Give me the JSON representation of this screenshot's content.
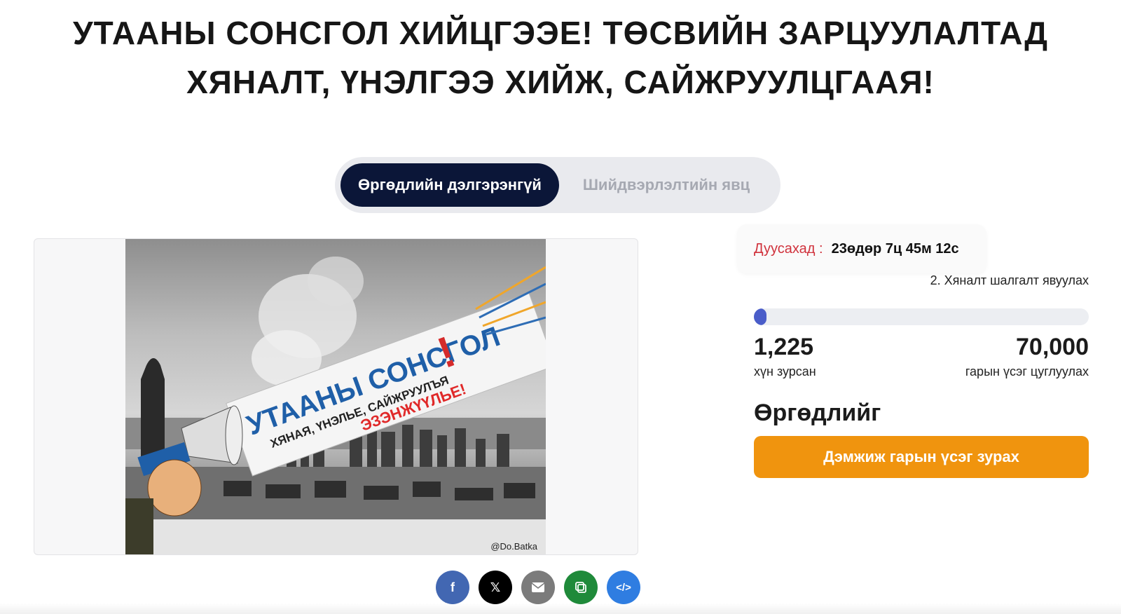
{
  "title": {
    "line1": "УТААНЫ СОНСГОЛ ХИЙЦГЭЭЕ! ТӨСВИЙН ЗАРЦУУЛАЛТАД",
    "line2": "ХЯНАЛТ, ҮНЭЛГЭЭ ХИЙЖ, САЙЖРУУЛЦГААЯ!"
  },
  "tabs": [
    {
      "label": "Өргөдлийн дэлгэрэнгүй",
      "active": true
    },
    {
      "label": "Шийдвэрлэлтийн явц",
      "active": false
    }
  ],
  "poster": {
    "headline": "УТААНЫ СОНСГОЛ",
    "exclaim": "!",
    "subline": "ХЯНАЯ, ҮНЭЛЬЕ, САЙЖРУУЛЪЯ",
    "accent_line": "ЭЗЭНЖҮҮЛЬЕ!",
    "credit": "@Do.Batka"
  },
  "countdown": {
    "label": "Дуусахад :",
    "value": "23өдөр 7ц 45м 12с"
  },
  "stage": "2. Хяналт шалгалт явуулах",
  "progress": {
    "signed": "1,225",
    "signed_label": "хүн зурсан",
    "goal": "70,000",
    "goal_label": "гарын үсэг цуглуулах",
    "fraction": 0.0175
  },
  "petition_heading": "Өргөдлийг",
  "sign_button": "Дэмжиж гарын үсэг зурах",
  "share": [
    {
      "icon": "facebook-icon",
      "glyph": "f",
      "color": "#4267b2"
    },
    {
      "icon": "x-icon",
      "glyph": "𝕏",
      "color": "#000000"
    },
    {
      "icon": "email-icon",
      "glyph": "",
      "color": "#7b7b7b"
    },
    {
      "icon": "copy-icon",
      "glyph": "",
      "color": "#1f8a3a"
    },
    {
      "icon": "embed-icon",
      "glyph": "</>",
      "color": "#2f7de1"
    }
  ],
  "colors": {
    "tab_active_bg": "#0b1638",
    "accent_orange": "#f0940e",
    "countdown_red": "#d0323c",
    "progress_fill": "#4a5dc9"
  }
}
